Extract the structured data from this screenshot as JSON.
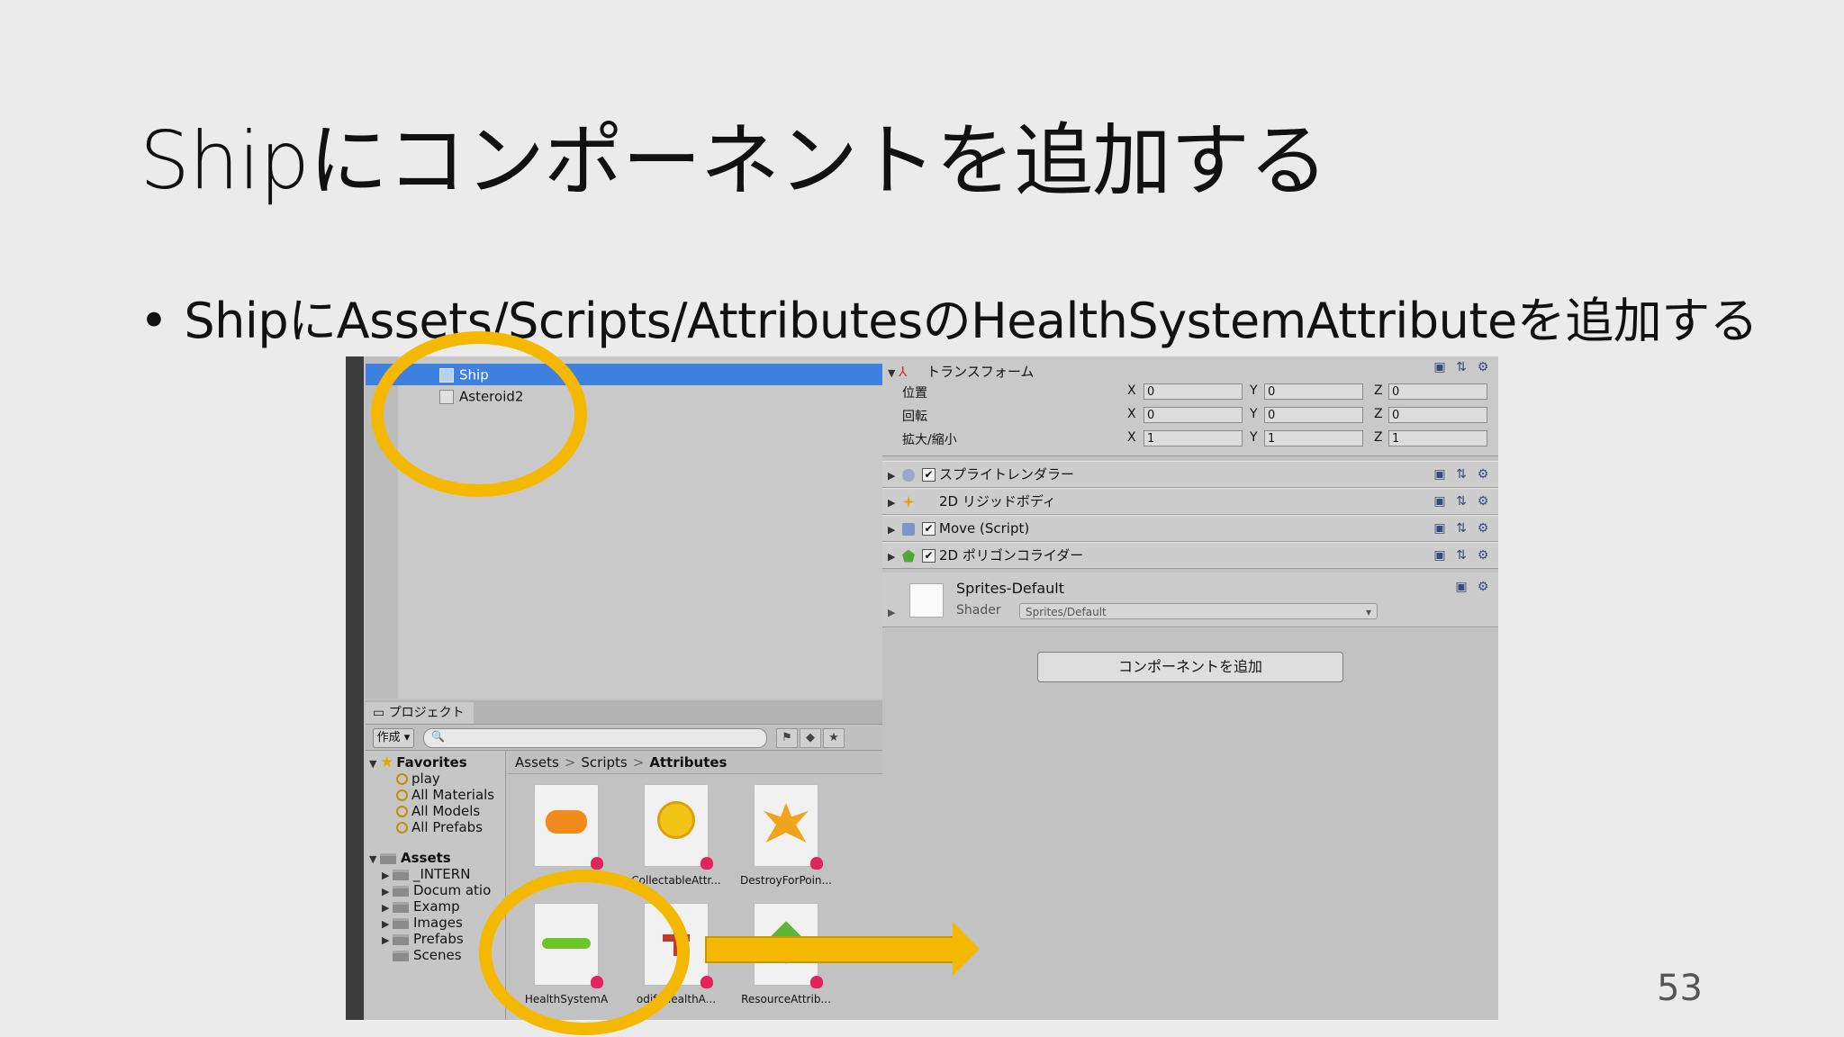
{
  "slide": {
    "title": "Shipにコンポーネントを追加する",
    "bullet": "ShipにAssets/Scripts/AttributesのHealthSystemAttributeを追加する",
    "page_number": "53"
  },
  "hierarchy": {
    "items": [
      {
        "label": "Ship",
        "selected": true
      },
      {
        "label": "Asteroid2",
        "selected": false
      }
    ]
  },
  "project": {
    "tab_label": "プロジェクト",
    "create_label": "作成",
    "search_placeholder": "",
    "favorites": {
      "label": "Favorites",
      "items": [
        "play",
        "All Materials",
        "All Models",
        "All Prefabs"
      ]
    },
    "assets": {
      "label": "Assets",
      "items": [
        "_INTERN",
        "Docum atio",
        "Examp",
        "Images",
        "Prefabs",
        "Scenes"
      ]
    },
    "breadcrumb": [
      "Assets",
      "Scripts",
      "Attributes"
    ],
    "files": [
      {
        "label": "",
        "color": "#f08a1a"
      },
      {
        "label": "CollectableAttr...",
        "color": "#f2c418"
      },
      {
        "label": "DestroyForPoin...",
        "color": "#f3a21c"
      },
      {
        "label": "HealthSystemA",
        "color": "#6cc62a"
      },
      {
        "label": "odifyHealthA...",
        "color": "#c0392b"
      },
      {
        "label": "ResourceAttrib...",
        "color": "#5fb534"
      }
    ]
  },
  "inspector": {
    "transform": {
      "title": "トランスフォーム",
      "rows": [
        {
          "label": "位置",
          "x": "0",
          "y": "0",
          "z": "0"
        },
        {
          "label": "回転",
          "x": "0",
          "y": "0",
          "z": "0"
        },
        {
          "label": "拡大/縮小",
          "x": "1",
          "y": "1",
          "z": "1"
        }
      ],
      "axis_x": "X",
      "axis_y": "Y",
      "axis_z": "Z"
    },
    "components": [
      {
        "label": "スプライトレンダラー",
        "checked": true
      },
      {
        "label": "2D リジッドボディ",
        "checked": false
      },
      {
        "label": "Move (Script)",
        "checked": true
      },
      {
        "label": "2D ポリゴンコライダー",
        "checked": true
      }
    ],
    "material": {
      "name": "Sprites-Default",
      "shader_label": "Shader",
      "shader_value": "Sprites/Default"
    },
    "add_component_label": "コンポーネントを追加"
  },
  "colors": {
    "highlight": "#f5b800",
    "selection": "#3d80df"
  }
}
